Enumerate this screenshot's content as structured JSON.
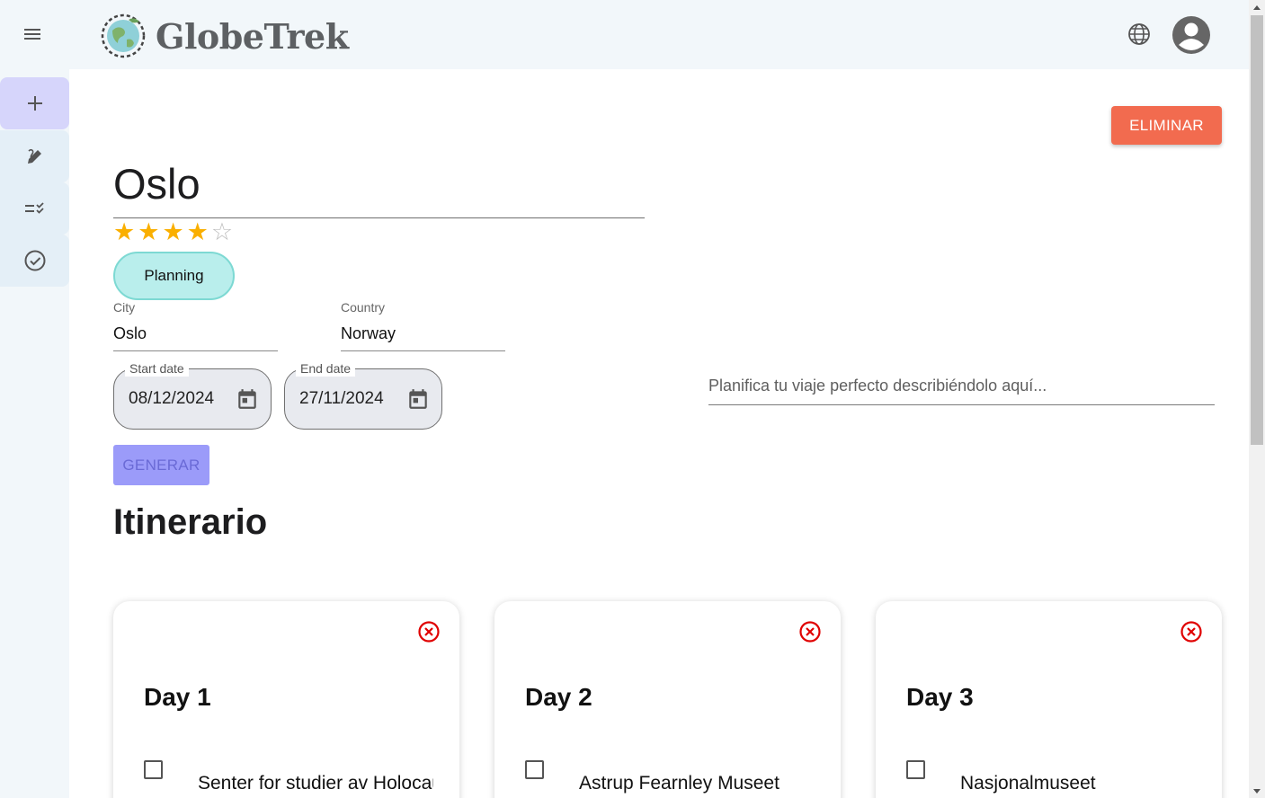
{
  "app": {
    "name": "GlobeTrek",
    "icons": {
      "menu": "menu-icon",
      "language": "globe-icon",
      "account": "account-circle-icon"
    }
  },
  "sidebar": {
    "items": [
      {
        "name": "add",
        "icon": "plus-icon",
        "active": true
      },
      {
        "name": "edit-trips",
        "icon": "edit-pen-icon",
        "active": false
      },
      {
        "name": "checklist",
        "icon": "checklist-icon",
        "active": false
      },
      {
        "name": "completed",
        "icon": "check-circle-icon",
        "active": false
      }
    ]
  },
  "trip": {
    "delete_label": "ELIMINAR",
    "title": "Oslo",
    "rating": 4,
    "rating_max": 5,
    "status": "Planning",
    "city_label": "City",
    "city": "Oslo",
    "country_label": "Country",
    "country": "Norway",
    "start_label": "Start date",
    "start_date": "08/12/2024",
    "end_label": "End date",
    "end_date": "27/11/2024",
    "plan_placeholder": "Planifica tu viaje perfecto describiéndolo aquí...",
    "generate_label": "GENERAR"
  },
  "itinerary": {
    "title": "Itinerario",
    "days": [
      {
        "label": "Day 1",
        "activity": "Senter for studier av Holocaust og livssynsminoriteter"
      },
      {
        "label": "Day 2",
        "activity": "Astrup Fearnley Museet"
      },
      {
        "label": "Day 3",
        "activity": "Nasjonalmuseet"
      }
    ]
  },
  "colors": {
    "delete": "#f26b4f",
    "status_chip": "#b9eeec",
    "star": "#faaf00",
    "generate": "#9b9bf9",
    "remove_icon": "#e00000",
    "sidebar_active": "#d6d5fb"
  }
}
